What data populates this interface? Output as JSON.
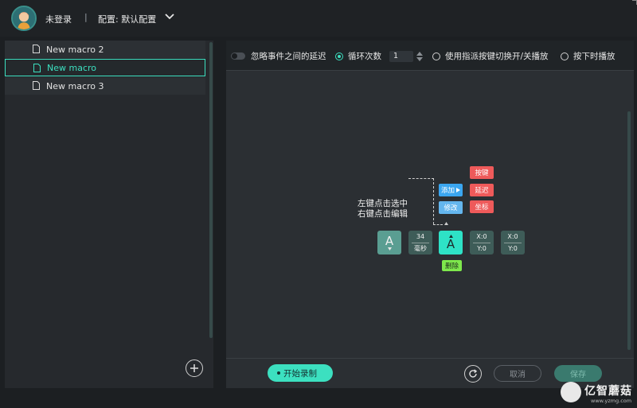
{
  "header": {
    "login_status": "未登录",
    "separator": "|",
    "config_label": "配置: 默认配置"
  },
  "macros": [
    {
      "label": "New macro 2",
      "active": false
    },
    {
      "label": "New macro",
      "active": true
    },
    {
      "label": "New macro 3",
      "active": false
    }
  ],
  "options": {
    "ignore_delay": "忽略事件之间的延迟",
    "loop_count_label": "循环次数",
    "loop_count_value": "1",
    "toggle_play": "使用指派按键切换开/关播放",
    "hold_play": "按下时播放"
  },
  "help": {
    "line1": "左键点击选中",
    "line2": "右键点击编辑"
  },
  "events": {
    "key1_label": "A",
    "delay_value": "34",
    "delay_unit": "毫秒",
    "key2_label": "A",
    "coord1_x": "X:0",
    "coord1_y": "Y:0",
    "coord2_x": "X:0",
    "coord2_y": "Y:0"
  },
  "menu": {
    "add": "添加",
    "edit": "修改",
    "key": "按键",
    "delay": "延迟",
    "coord": "坐标",
    "delete": "删除"
  },
  "footer": {
    "record": "开始录制",
    "cancel": "取消",
    "save": "保存"
  },
  "watermark": {
    "cn": "亿智蘑菇",
    "en": "www.yzmg.com"
  },
  "colors": {
    "accent": "#3ce0c0",
    "red": "#ee5a5a",
    "blue": "#3aa6f0",
    "green": "#7ee84c"
  }
}
